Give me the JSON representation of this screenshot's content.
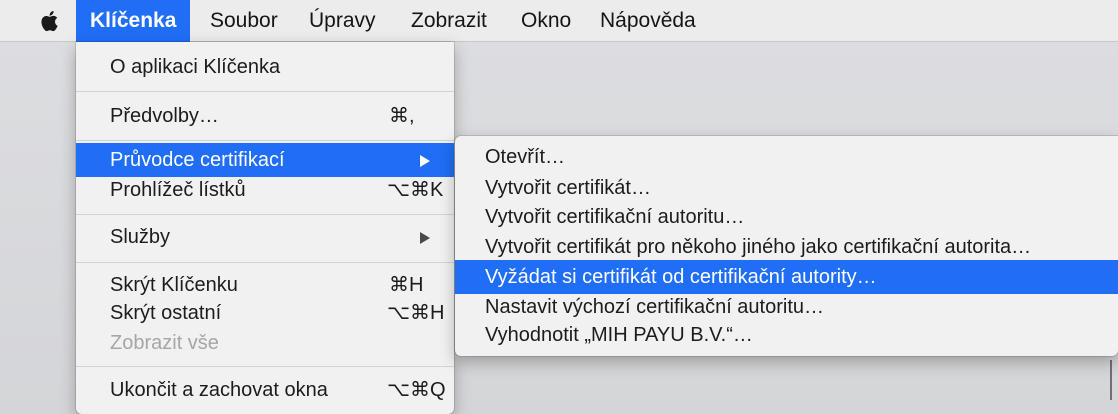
{
  "menubar": {
    "apple_icon": "apple-logo-icon",
    "items": [
      "Klíčenka",
      "Soubor",
      "Úpravy",
      "Zobrazit",
      "Okno",
      "Nápověda"
    ]
  },
  "main_menu": {
    "items": [
      {
        "label": "O aplikaci Klíčenka",
        "shortcut": ""
      },
      {
        "label": "Předvolby…",
        "shortcut": "⌘,"
      },
      {
        "label": "Průvodce certifikací",
        "shortcut": "",
        "submenu": true,
        "highlighted": true
      },
      {
        "label": "Prohlížeč lístků",
        "shortcut": "⌥⌘K"
      },
      {
        "label": "Služby",
        "shortcut": "",
        "submenu": true
      },
      {
        "label": "Skrýt Klíčenku",
        "shortcut": "⌘H"
      },
      {
        "label": "Skrýt ostatní",
        "shortcut": "⌥⌘H"
      },
      {
        "label": "Zobrazit vše",
        "shortcut": "",
        "disabled": true
      },
      {
        "label": "Ukončit a zachovat okna",
        "shortcut": "⌥⌘Q"
      }
    ]
  },
  "sub_menu": {
    "items": [
      {
        "label": "Otevřít…"
      },
      {
        "label": "Vytvořit certifikát…"
      },
      {
        "label": "Vytvořit certifikační autoritu…"
      },
      {
        "label": "Vytvořit certifikát pro někoho jiného jako certifikační autorita…"
      },
      {
        "label": "Vyžádat si certifikát od certifikační autority…",
        "highlighted": true
      },
      {
        "label": "Nastavit výchozí certifikační autoritu…"
      },
      {
        "label": "Vyhodnotit „MIH PAYU B.V.“…"
      }
    ]
  },
  "colors": {
    "accent": "#1f6ef5",
    "menu_bg": "#f1f1f2",
    "menubar_bg": "#ececec",
    "disabled_text": "#a6a6a6"
  }
}
